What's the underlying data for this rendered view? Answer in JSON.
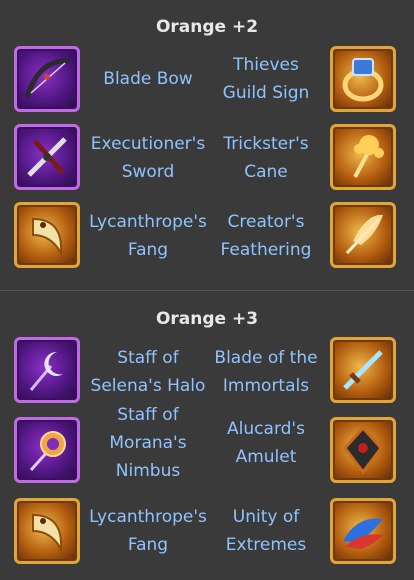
{
  "sections": [
    {
      "title": "Orange +2",
      "rows": [
        {
          "left": {
            "name": "Blade Bow",
            "icon": "blade-bow-icon",
            "frame": "purple"
          },
          "right": {
            "name": "Thieves Guild Sign",
            "icon": "ring-icon",
            "frame": "gold"
          }
        },
        {
          "left": {
            "name": "Executioner's Sword",
            "icon": "sword-icon",
            "frame": "purple"
          },
          "right": {
            "name": "Trickster's Cane",
            "icon": "cane-icon",
            "frame": "gold"
          }
        },
        {
          "left": {
            "name": "Lycanthrope's Fang",
            "icon": "fang-icon",
            "frame": "gold"
          },
          "right": {
            "name": "Creator's Feathering",
            "icon": "feather-icon",
            "frame": "gold"
          }
        }
      ]
    },
    {
      "title": "Orange +3",
      "rows": [
        {
          "left": {
            "name": "Staff of Selena's Halo",
            "icon": "moon-staff-icon",
            "frame": "purple"
          },
          "right": {
            "name": "Blade of the Immortals",
            "icon": "blade-icon",
            "frame": "gold"
          }
        },
        {
          "left": {
            "name": "Staff of Morana's Nimbus",
            "icon": "sun-staff-icon",
            "frame": "purple"
          },
          "right": {
            "name": "Alucard's Amulet",
            "icon": "amulet-icon",
            "frame": "gold"
          }
        },
        {
          "left": {
            "name": "Lycanthrope's Fang",
            "icon": "fang-icon",
            "frame": "gold"
          },
          "right": {
            "name": "Unity of Extremes",
            "icon": "dragon-icon",
            "frame": "gold"
          }
        }
      ]
    }
  ]
}
